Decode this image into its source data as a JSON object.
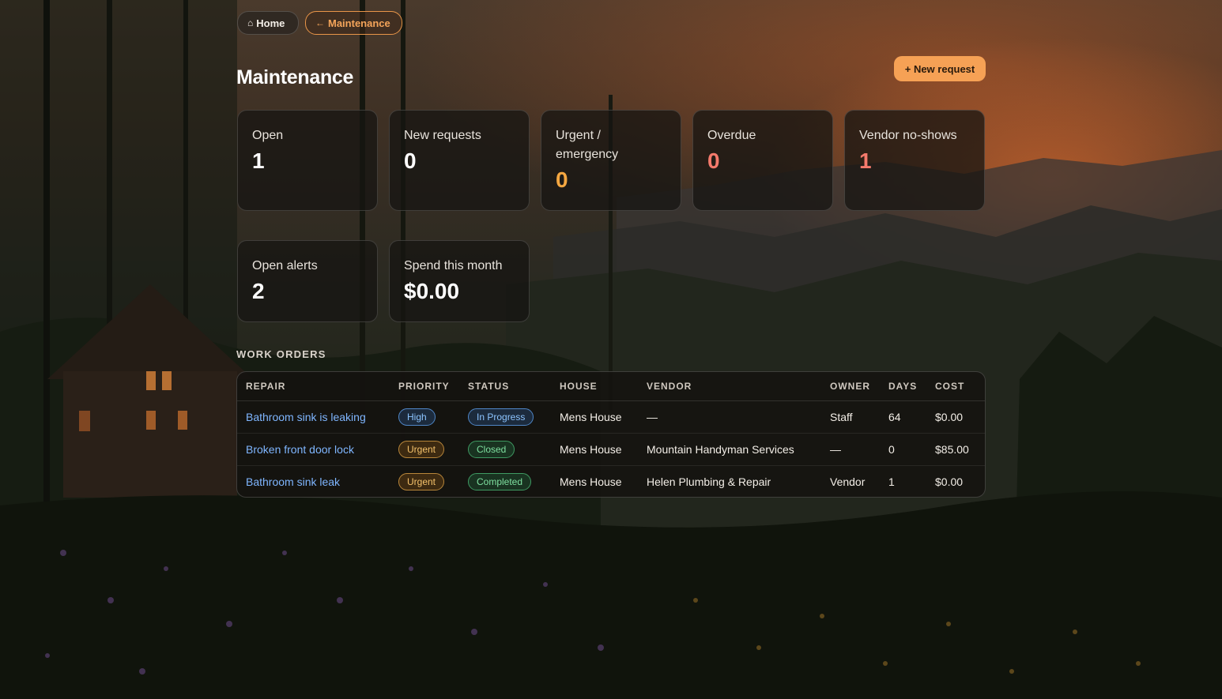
{
  "breadcrumb": {
    "home_label": "Home",
    "home_icon": "house-icon",
    "current_label": "Maintenance",
    "current_icon": "arrow-left-icon"
  },
  "page": {
    "title": "Maintenance",
    "new_request_label": "+ New request"
  },
  "stats": {
    "open": {
      "label": "Open",
      "value": "1"
    },
    "new_requests": {
      "label": "New requests",
      "value": "0"
    },
    "urgent": {
      "label": "Urgent / emergency",
      "value": "0"
    },
    "overdue": {
      "label": "Overdue",
      "value": "0"
    },
    "vendor_no_shows": {
      "label": "Vendor no-shows",
      "value": "1"
    },
    "open_alerts": {
      "label": "Open alerts",
      "value": "2"
    },
    "spend_month": {
      "label": "Spend this month",
      "value": "$0.00"
    }
  },
  "colors": {
    "accent": "#f6a155",
    "warning_value": "#f4a741",
    "danger_value": "#f47a6c",
    "link": "#7fb6ff"
  },
  "work_orders": {
    "section_label": "WORK ORDERS",
    "columns": [
      "REPAIR",
      "PRIORITY",
      "STATUS",
      "HOUSE",
      "VENDOR",
      "OWNER",
      "DAYS",
      "COST"
    ],
    "rows": [
      {
        "repair": "Bathroom sink is leaking",
        "priority": "High",
        "status": "In Progress",
        "house": "Mens House",
        "vendor": "—",
        "owner": "Staff",
        "days": "64",
        "cost": "$0.00"
      },
      {
        "repair": "Broken front door lock",
        "priority": "Urgent",
        "status": "Closed",
        "house": "Mens House",
        "vendor": "Mountain Handyman Services",
        "owner": "—",
        "days": "0",
        "cost": "$85.00"
      },
      {
        "repair": "Bathroom sink leak",
        "priority": "Urgent",
        "status": "Completed",
        "house": "Mens House",
        "vendor": "Helen Plumbing & Repair",
        "owner": "Vendor",
        "days": "1",
        "cost": "$0.00"
      }
    ]
  }
}
